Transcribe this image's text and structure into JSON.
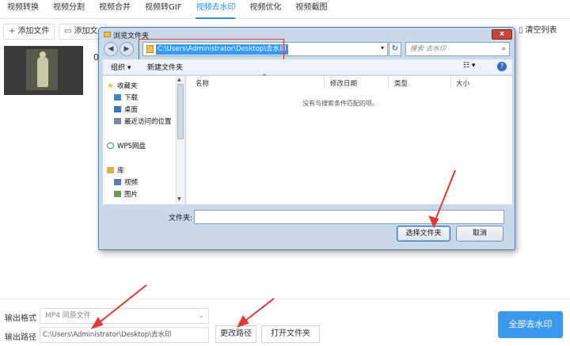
{
  "tabs": [
    "视频转换",
    "视频分割",
    "视频合并",
    "视频转GIF",
    "视频去水印",
    "视频优化",
    "视频截图"
  ],
  "toolbar": {
    "add_file": "添加文件",
    "add_folder": "添加文",
    "clear_list": "清空列表"
  },
  "file_list": {
    "name_snippet": "0"
  },
  "bottom": {
    "format_label": "输出格式",
    "format_value": "MP4  同原文件",
    "path_label": "输出路径",
    "path_value": "C:\\Users\\Administrator\\Desktop\\去水印",
    "change_path": "更改路径",
    "open_folder": "打开文件夹",
    "remove_all": "全部去水印"
  },
  "dialog": {
    "title": "浏览文件夹",
    "close": "x",
    "address": "C:\\Users\\Administrator\\Desktop\\去水印",
    "search_placeholder": "搜索 去水印",
    "organize": "组织 ▾",
    "new_folder": "新建文件夹",
    "help": "?",
    "nav": {
      "favorites": "收藏夹",
      "downloads": "下载",
      "desktop": "桌面",
      "recent": "最近访问的位置",
      "wps": "WPS网盘",
      "libraries": "库",
      "videos": "视频",
      "pictures": "图片"
    },
    "columns": [
      "名称",
      "修改日期",
      "类型",
      "大小"
    ],
    "empty_message": "没有与搜索条件匹配的项。",
    "folder_label": "文件夹:",
    "folder_value": "",
    "select_button": "选择文件夹",
    "cancel_button": "取消"
  },
  "colors": {
    "accent": "#2f8fe6",
    "primary_button": "#3b99f0",
    "annotation_red": "#e53935",
    "selection": "#3399ff"
  }
}
